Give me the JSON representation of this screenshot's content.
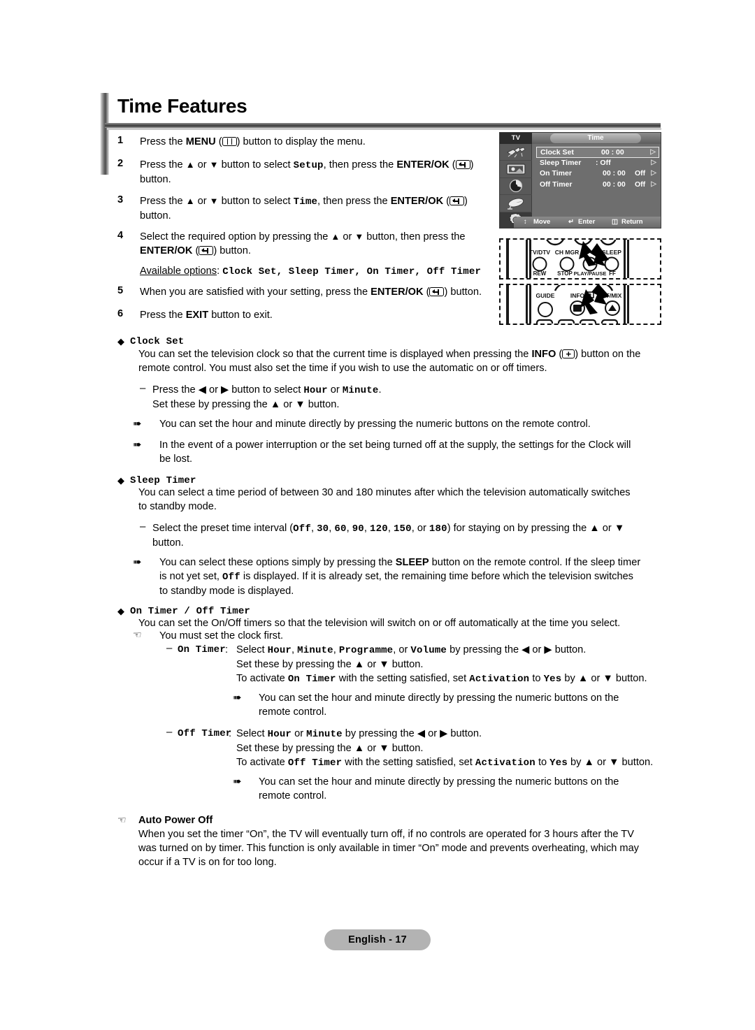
{
  "document": {
    "title": "Time Features",
    "footer_label": "English - 17"
  },
  "steps": [
    {
      "num": "1",
      "parts": [
        {
          "t": "Press the ",
          "s": "n"
        },
        {
          "t": "MENU",
          "s": "b"
        },
        {
          "t": " (",
          "s": "n"
        },
        {
          "t": "menu-key-icon",
          "s": "icon"
        },
        {
          "t": ") button to display the menu.",
          "s": "n"
        }
      ]
    },
    {
      "num": "2",
      "parts": [
        {
          "t": "Press the ",
          "s": "n"
        },
        {
          "t": "▲",
          "s": "n"
        },
        {
          "t": " or ",
          "s": "n"
        },
        {
          "t": "▼",
          "s": "n"
        },
        {
          "t": " button to select ",
          "s": "n"
        },
        {
          "t": "Setup",
          "s": "m"
        },
        {
          "t": ", then press the ",
          "s": "n"
        },
        {
          "t": "ENTER/OK",
          "s": "b"
        },
        {
          "t": " (",
          "s": "n"
        },
        {
          "t": "enter-key-icon",
          "s": "icon"
        },
        {
          "t": ")",
          "s": "n"
        },
        {
          "t": "\nbutton.",
          "s": "n"
        }
      ]
    },
    {
      "num": "3",
      "parts": [
        {
          "t": "Press the ",
          "s": "n"
        },
        {
          "t": "▲",
          "s": "n"
        },
        {
          "t": " or ",
          "s": "n"
        },
        {
          "t": "▼",
          "s": "n"
        },
        {
          "t": " button to select ",
          "s": "n"
        },
        {
          "t": "Time",
          "s": "m"
        },
        {
          "t": ", then press the ",
          "s": "n"
        },
        {
          "t": "ENTER/OK",
          "s": "b"
        },
        {
          "t": " (",
          "s": "n"
        },
        {
          "t": "enter-key-icon",
          "s": "icon"
        },
        {
          "t": ")",
          "s": "n"
        },
        {
          "t": "\nbutton.",
          "s": "n"
        }
      ]
    },
    {
      "num": "4",
      "parts": [
        {
          "t": "Select the required option by pressing the ▲ or ▼ button, then press the\n",
          "s": "n"
        },
        {
          "t": "ENTER/OK",
          "s": "b"
        },
        {
          "t": " (",
          "s": "n"
        },
        {
          "t": "enter-key-icon",
          "s": "icon"
        },
        {
          "t": ") button.",
          "s": "n"
        }
      ]
    },
    {
      "num": "5",
      "parts": [
        {
          "t": "When you are satisfied with your setting, press the ",
          "s": "n"
        },
        {
          "t": "ENTER/OK",
          "s": "b"
        },
        {
          "t": " (",
          "s": "n"
        },
        {
          "t": "enter-key-icon",
          "s": "icon"
        },
        {
          "t": ") button.",
          "s": "n"
        }
      ]
    },
    {
      "num": "6",
      "parts": [
        {
          "t": "Press the ",
          "s": "n"
        },
        {
          "t": "EXIT",
          "s": "b"
        },
        {
          "t": " button to exit.",
          "s": "n"
        }
      ]
    }
  ],
  "available_options": {
    "label": "Available options",
    "colon": ": ",
    "values": "Clock Set, Sleep Timer, On Timer, Off Timer"
  },
  "sections": {
    "clock_set": {
      "heading": "Clock Set",
      "body_line1_a": "You can set the television clock so that the current time is displayed when pressing the ",
      "body_info": "INFO",
      "body_line1_b": ") button on the",
      "body_line2": "remote control. You must also set the time if you wish to use the automatic on or off timers.",
      "dash1_a": "Press the ◀ or ▶ button to select ",
      "dash1_mono1": "Hour",
      "dash1_mid": " or ",
      "dash1_mono2": "Minute",
      "dash1_end": ".",
      "dash1_line2": "Set these by pressing the ▲ or ▼ button.",
      "note1": "You can set the hour and minute directly by pressing the numeric buttons on the remote control.",
      "note2_line1": "In the event of a power interruption or the set being turned off at the supply, the settings for the Clock will",
      "note2_line2": "be lost."
    },
    "sleep_timer": {
      "heading": "Sleep Timer",
      "body_line1": "You can select a time period of between 30 and 180 minutes after which the television automatically switches",
      "body_line2": "to standby mode.",
      "dash_pre": "Select the preset time interval (",
      "dash_values": [
        "Off",
        "30",
        "60",
        "90",
        "120",
        "150",
        "180"
      ],
      "dash_mid": ", or ",
      "dash_post": ") for staying on by pressing the ▲ or ▼",
      "dash_line2": "button.",
      "note_a": "You can select these options simply by pressing the ",
      "note_sleep": "SLEEP",
      "note_b": " button on the remote control. If the sleep timer",
      "note_line2_a": "is not yet set, ",
      "note_line2_off": "Off",
      "note_line2_b": " is displayed. If it is already set, the remaining time before which the television switches",
      "note_line3": "to standby mode is displayed."
    },
    "on_off_timer": {
      "heading": "On Timer / Off Timer",
      "body_line1": "You can set the On/Off timers so that the television will switch on or off automatically at the time you select.",
      "hand_note": "You must set the clock first.",
      "on_timer": {
        "label": "On Timer",
        "colon": ":",
        "line1_a": "Select ",
        "line1_monos": [
          "Hour",
          "Minute",
          "Programme",
          "Volume"
        ],
        "line1_b": " by pressing the ◀ or ▶ button.",
        "line2": "Set these by pressing the ▲ or ▼ button.",
        "line3_a": "To activate ",
        "line3_mono1": "On Timer",
        "line3_b": " with the setting satisfied, set ",
        "line3_mono2": "Activation",
        "line3_c": " to ",
        "line3_mono3": "Yes",
        "line3_d": " by ▲ or ▼ button."
      },
      "on_timer_note_line1": "You can set the hour and minute directly by pressing the numeric buttons on the",
      "on_timer_note_line2": "remote control.",
      "off_timer": {
        "label": "Off Timer",
        "colon": ":",
        "line1_a": "Select ",
        "line1_mono1": "Hour",
        "line1_mid": " or ",
        "line1_mono2": "Minute",
        "line1_b": " by pressing the ◀ or ▶ button.",
        "line2": "Set these by pressing the ▲ or ▼ button.",
        "line3_a": "To activate ",
        "line3_mono1": "Off Timer",
        "line3_b": " with the setting satisfied, set ",
        "line3_mono2": "Activation",
        "line3_c": " to ",
        "line3_mono3": "Yes",
        "line3_d": " by ▲ or ▼ button."
      },
      "off_timer_note_line1": "You can set the hour and minute directly by pressing the numeric buttons on the",
      "off_timer_note_line2": "remote control."
    },
    "auto_power_off": {
      "heading": "Auto Power Off",
      "line1": "When you set the timer “On”, the TV will eventually turn off, if no controls are operated for 3 hours after the TV",
      "line2": "was turned on by timer. This function is only available in timer “On” mode and prevents overheating, which may",
      "line3": "occur if a TV is on for too long."
    }
  },
  "osd": {
    "source_label": "TV",
    "menu_title": "Time",
    "sidebar_icons": [
      "input-plug-icon",
      "picture-icon",
      "sound-icon",
      "channel-dish-icon",
      "setup-gear-icon"
    ],
    "selected_sidebar_index": 4,
    "rows": [
      {
        "label": "Clock Set",
        "value": "00 : 00",
        "value2": "",
        "chevron": "▷",
        "selected": true
      },
      {
        "label": "Sleep Timer",
        "value": ": Off",
        "value2": "",
        "chevron": "▷",
        "selected": false
      },
      {
        "label": "On Timer",
        "value": "00 : 00",
        "value2": "Off",
        "chevron": "▷",
        "selected": false
      },
      {
        "label": "Off Timer",
        "value": "00 : 00",
        "value2": "Off",
        "chevron": "▷",
        "selected": false
      }
    ],
    "footer": {
      "move": "Move",
      "enter": "Enter",
      "return": "Return"
    }
  },
  "remote_top": {
    "labels_upper": [
      "TV/DTV",
      "CH MGR",
      "SLEEP"
    ],
    "labels_lower": [
      "REW",
      "STOP",
      "PLAY/PAUSE",
      "FF"
    ],
    "highlight": "SLEEP"
  },
  "remote_bottom": {
    "labels": [
      "GUIDE",
      "INFO",
      "T/MIX"
    ],
    "highlight": "INFO"
  }
}
